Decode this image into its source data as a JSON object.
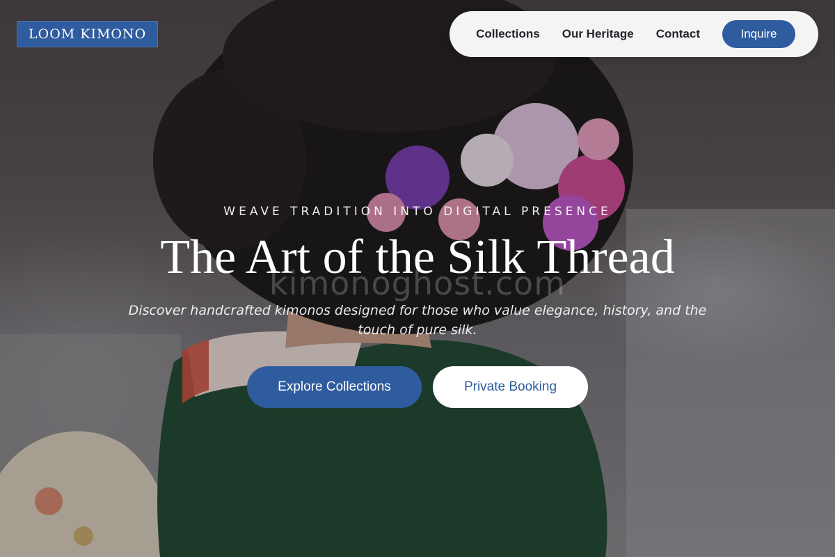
{
  "colors": {
    "brand_blue": "#2f5c9e",
    "nav_bg": "#f4f4f5",
    "nav_text": "#23262c",
    "white": "#ffffff"
  },
  "header": {
    "logo": "LOOM KIMONO",
    "nav": {
      "links": [
        "Collections",
        "Our Heritage",
        "Contact"
      ],
      "cta": "Inquire"
    }
  },
  "hero": {
    "eyebrow": "WEAVE TRADITION INTO DIGITAL PRESENCE",
    "headline": "The Art of the Silk Thread",
    "watermark": "kimonoghost.com",
    "subhead": "Discover handcrafted kimonos designed for those who value elegance, history, and the touch of pure silk.",
    "primary_button": "Explore Collections",
    "secondary_button": "Private Booking",
    "image_subject": "woman-with-floral-hair-ornament-in-green-kimono"
  }
}
